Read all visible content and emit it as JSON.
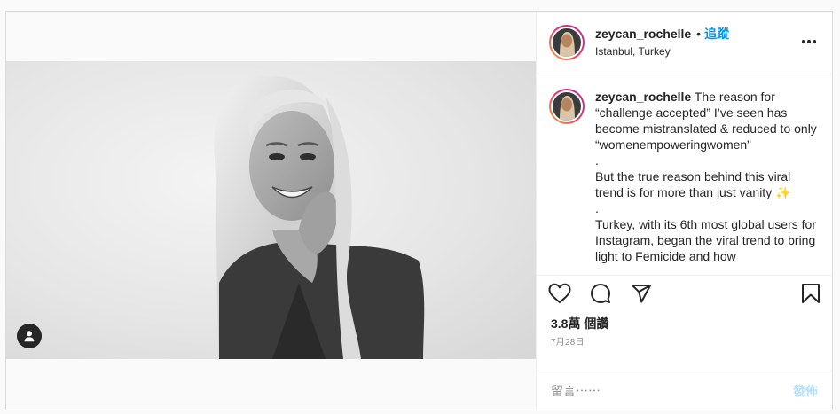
{
  "post": {
    "username": "zeycan_rochelle",
    "follow_label": "追蹤",
    "separator": "•",
    "location": "Istanbul, Turkey",
    "caption_text": " The reason for “challenge accepted” I’ve seen has become mistranslated & reduced to only “womenempoweringwomen”\n.\nBut the true reason behind this viral trend is for more than just vanity ✨\n.\nTurkey, with its 6th most global users for Instagram, began the viral trend to bring light to Femicide and how",
    "likes": "3.8萬 個讚",
    "date": "7月28日"
  },
  "comment": {
    "placeholder": "留言⋯⋯",
    "post_label": "發佈"
  },
  "icons": {
    "like": "heart-icon",
    "comment": "comment-icon",
    "share": "share-icon",
    "save": "bookmark-icon",
    "more": "more-options-icon",
    "tag": "user-tag-icon"
  },
  "colors": {
    "link": "#0095f6",
    "post_disabled": "#b2dffc",
    "ring_start": "#f9a73f",
    "ring_end": "#b22d9b"
  }
}
